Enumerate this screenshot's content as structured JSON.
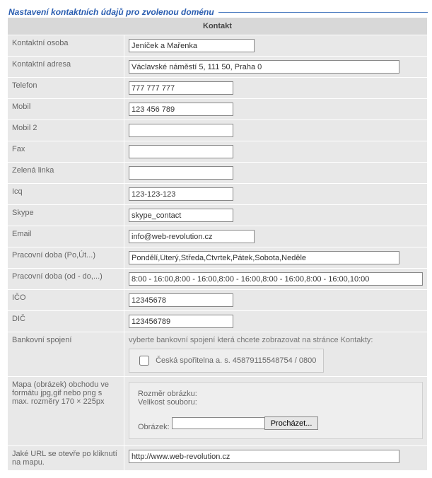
{
  "legend": "Nastavení kontaktních údajů pro zvolenou doménu",
  "header": "Kontakt",
  "fields": {
    "person": {
      "label": "Kontaktní osoba",
      "value": "Jeníček a Mařenka"
    },
    "address": {
      "label": "Kontaktní adresa",
      "value": "Václavské náměstí 5, 111 50, Praha 0"
    },
    "phone": {
      "label": "Telefon",
      "value": "777 777 777"
    },
    "mobile": {
      "label": "Mobil",
      "value": "123 456 789"
    },
    "mobile2": {
      "label": "Mobil 2",
      "value": ""
    },
    "fax": {
      "label": "Fax",
      "value": ""
    },
    "greenline": {
      "label": "Zelená linka",
      "value": ""
    },
    "icq": {
      "label": "Icq",
      "value": "123-123-123"
    },
    "skype": {
      "label": "Skype",
      "value": "skype_contact"
    },
    "email": {
      "label": "Email",
      "value": "info@web-revolution.cz"
    },
    "hours_days": {
      "label": "Pracovní doba (Po,Út...)",
      "value": "Pondělí,Úterý,Středa,Čtvrtek,Pátek,Sobota,Neděle"
    },
    "hours_times": {
      "label": "Pracovní doba (od - do,...)",
      "value": "8:00 - 16:00,8:00 - 16:00,8:00 - 16:00,8:00 - 16:00,8:00 - 16:00,10:00"
    },
    "ico": {
      "label": "IČO",
      "value": "12345678"
    },
    "dic": {
      "label": "DIČ",
      "value": "123456789"
    }
  },
  "bank": {
    "label": "Bankovní spojení",
    "hint": "vyberte bankovní spojení která chcete zobrazovat na stránce Kontakty:",
    "option": "Česká spořitelna a. s. 45879115548754 / 0800"
  },
  "map": {
    "label": "Mapa (obrázek) obchodu ve formátu jpg,gif nebo png s max. rozměry 170 × 225px",
    "size_label": "Rozměr obrázku:",
    "filesize_label": "Velikost souboru:",
    "image_label": "Obrázek:",
    "browse": "Procházet..."
  },
  "mapurl": {
    "label": "Jaké URL se otevře po kliknutí na mapu.",
    "value": "http://www.web-revolution.cz"
  }
}
